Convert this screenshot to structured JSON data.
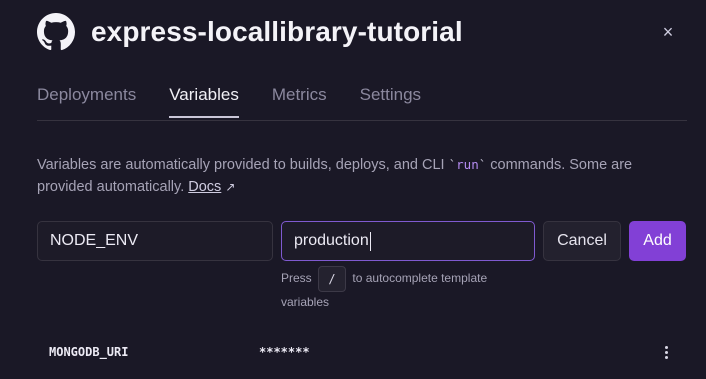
{
  "header": {
    "title": "express-locallibrary-tutorial",
    "icon": "github-icon",
    "close_label": "×"
  },
  "tabs": [
    {
      "label": "Deployments",
      "active": false
    },
    {
      "label": "Variables",
      "active": true
    },
    {
      "label": "Metrics",
      "active": false
    },
    {
      "label": "Settings",
      "active": false
    }
  ],
  "description": {
    "text_before": "Variables are automatically provided to builds, deploys, and CLI ",
    "code_open": "`",
    "code": "run",
    "code_close": "`",
    "text_after": " commands. Some are provided automatically. ",
    "docs_link": "Docs",
    "arrow": "↗"
  },
  "form": {
    "key_value": "NODE_ENV",
    "value_value": "production",
    "cancel_label": "Cancel",
    "add_label": "Add"
  },
  "hint": {
    "before": "Press",
    "key": "/",
    "after": "to autocomplete template",
    "line2": "variables"
  },
  "variables": [
    {
      "name": "MONGODB_URI",
      "value": "*******"
    }
  ],
  "colors": {
    "background": "#1a1826",
    "accent": "#8240d6",
    "focus_border": "#7f5ad0"
  }
}
